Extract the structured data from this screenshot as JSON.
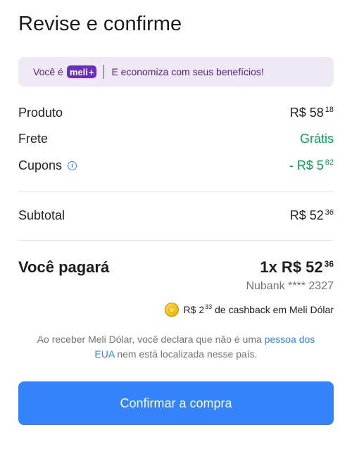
{
  "title": "Revise e confirme",
  "meli_banner": {
    "prefix": "Você é",
    "badge": "meli",
    "badge_plus": "+",
    "message": "E economiza com seus benefícios!"
  },
  "summary": {
    "produto": {
      "label": "Produto",
      "amount": "R$ 58",
      "cents": "18"
    },
    "frete": {
      "label": "Frete",
      "value": "Grátis"
    },
    "cupons": {
      "label": "Cupons",
      "info_icon": "i",
      "amount": "- R$ 5",
      "cents": "82"
    },
    "subtotal": {
      "label": "Subtotal",
      "amount": "R$ 52",
      "cents": "36"
    }
  },
  "total": {
    "label": "Você pagará",
    "amount": "1x R$ 52",
    "cents": "36",
    "payment_method": "Nubank **** 2327"
  },
  "cashback": {
    "amount": "R$ 2",
    "cents": "33",
    "text": "de cashback em Meli Dólar"
  },
  "disclaimer": {
    "before": "Ao receber Meli Dólar, você declara que não é uma",
    "link": "pessoa dos EUA",
    "after": "nem está localizada nesse país."
  },
  "confirm_button": "Confirmar a compra",
  "colors": {
    "primary": "#3483fa",
    "green": "#00a650",
    "meli_purple": "#6a2ec3",
    "banner_bg": "#efe9f5"
  }
}
